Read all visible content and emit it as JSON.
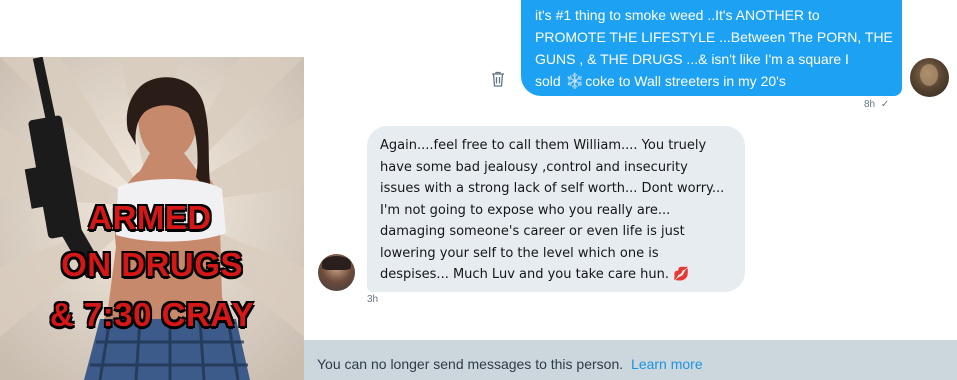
{
  "poster": {
    "line1": "ARMED",
    "line2": "ON DRUGS",
    "line3": "& 7:30 CRAY"
  },
  "outgoing_message": {
    "lines": [
      "it's #1 thing to smoke weed ..It's  ANOTHER to",
      "PROMOTE THE LIFESTYLE ...Between The PORN, THE",
      "GUNS , &  THE DRUGS ...& isn't like I'm a square I"
    ],
    "line4_before": "sold",
    "line4_after": "coke to Wall streeters in my 20's",
    "emoji": "❄️",
    "time": "8h",
    "status": "✓",
    "delete_icon": "trash-icon"
  },
  "incoming_message": {
    "lines": [
      "Again....feel free to call them William.... You truely",
      "have some bad jealousy ,control and insecurity",
      "issues with a strong lack of self worth... Dont worry...",
      "I'm not going to expose who you really are...",
      "damaging someone's career or even life is just",
      "lowering your self to the level which one is",
      "despises... Much Luv and you take care hun."
    ],
    "emoji": "💋",
    "time": "3h"
  },
  "notice": {
    "text": "You can no longer send messages to this person.",
    "link": "Learn more"
  },
  "colors": {
    "accent": "#1da1f2",
    "incoming_bubble": "#e6ecf0",
    "notice_bar": "#ccd6dd",
    "link": "#1b95e0"
  }
}
